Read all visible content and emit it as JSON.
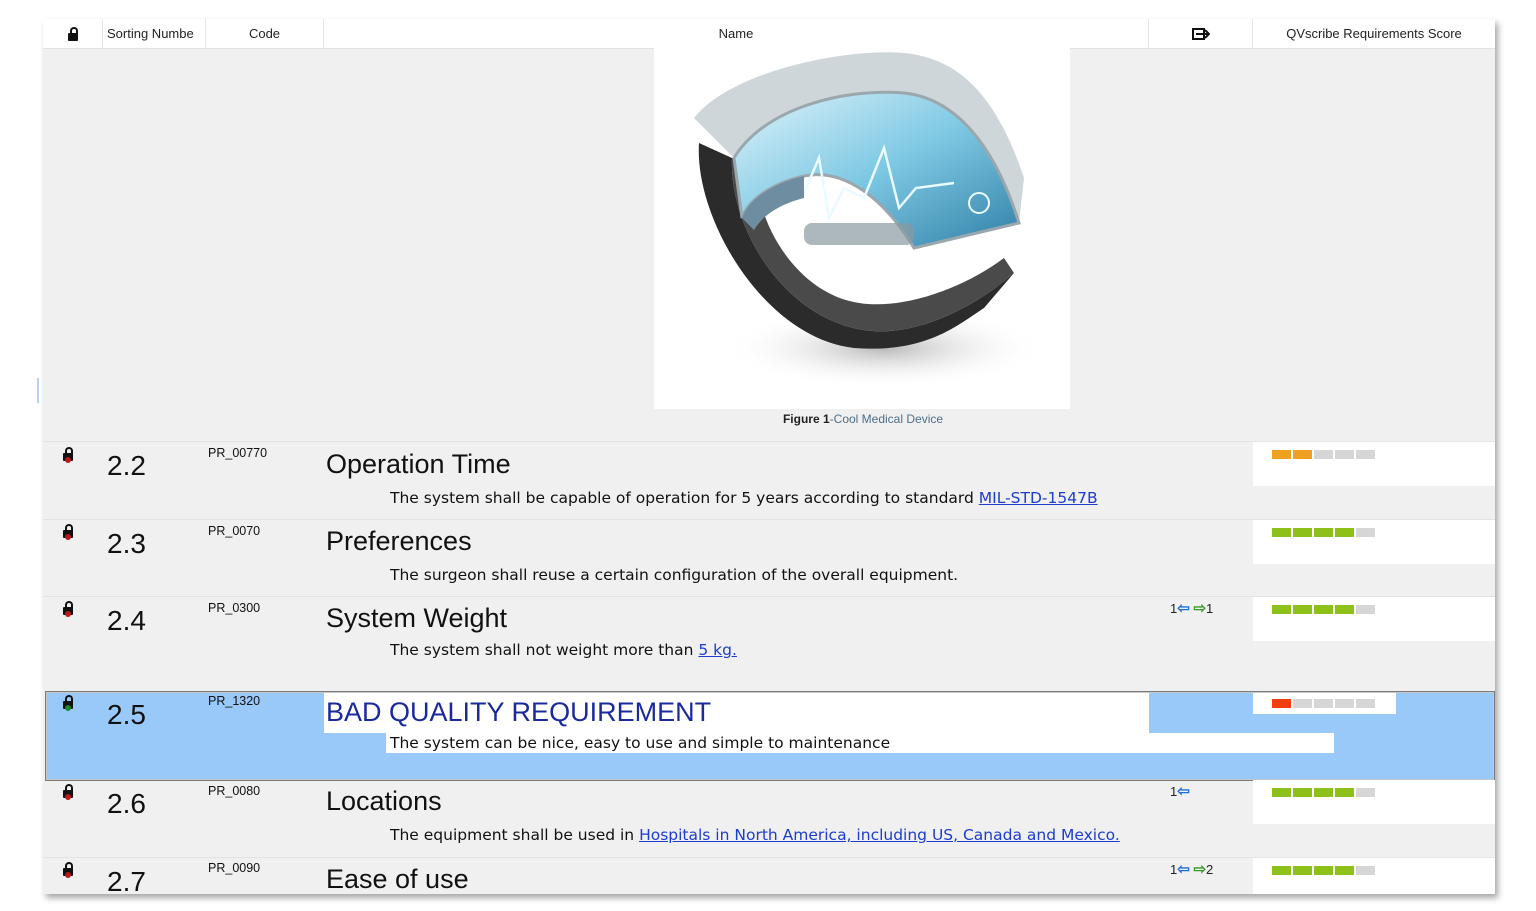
{
  "header": {
    "lock_icon": "lock-icon",
    "sorting_number": "Sorting Numbe",
    "code": "Code",
    "name": "Name",
    "links_icon": "link-in-out-icon",
    "score": "QVscribe Requirements Score"
  },
  "figure": {
    "label": "Figure 1",
    "text": "-Cool Medical Device"
  },
  "rows": [
    {
      "number": "2.2",
      "code": "PR_00770",
      "title": "Operation Time",
      "description": "The system shall be capable of operation for 5 years according to standard ",
      "link_text": "MIL-STD-1547B",
      "links": "",
      "score": {
        "filled": 2,
        "total": 5,
        "color": "#f0a020"
      }
    },
    {
      "number": "2.3",
      "code": "PR_0070",
      "title": "Preferences",
      "description": "The surgeon shall  reuse a certain configuration of the overall equipment.",
      "link_text": "",
      "links": "",
      "score": {
        "filled": 4,
        "total": 5,
        "color": "#8dc11a"
      }
    },
    {
      "number": "2.4",
      "code": "PR_0300",
      "title": "System Weight",
      "description": "The system shall not weight more than ",
      "link_text": "5 kg.",
      "links_in": "1",
      "links_out": "1",
      "score": {
        "filled": 4,
        "total": 5,
        "color": "#8dc11a"
      }
    },
    {
      "number": "2.5",
      "code": "PR_1320",
      "title": "BAD QUALITY REQUIREMENT",
      "description": "The system can be nice, easy to use and simple to maintenance",
      "link_text": "",
      "links": "",
      "selected": true,
      "score": {
        "filled": 1,
        "total": 5,
        "color": "#f04010"
      }
    },
    {
      "number": "2.6",
      "code": "PR_0080",
      "title": "Locations",
      "description": "The equipment shall be used in ",
      "link_text": "Hospitals in North America, including US, Canada and Mexico.",
      "links_in": "1",
      "score": {
        "filled": 4,
        "total": 5,
        "color": "#8dc11a"
      }
    },
    {
      "number": "2.7",
      "code": "PR_0090",
      "title": "Ease of use",
      "description": "",
      "link_text": "",
      "links_in": "1",
      "links_out": "2",
      "score": {
        "filled": 4,
        "total": 5,
        "color": "#8dc11a"
      }
    }
  ],
  "colors": {
    "selection": "#99c9f9",
    "link": "#1d3dcc",
    "bad_title": "#1a2a9c"
  }
}
